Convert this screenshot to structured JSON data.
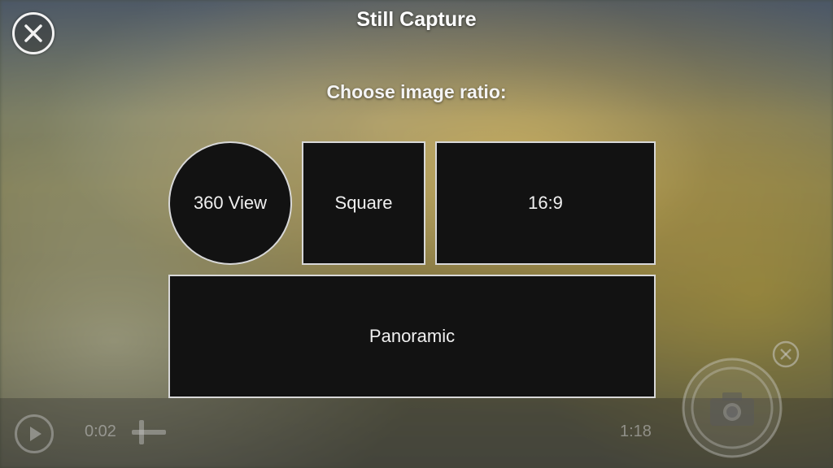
{
  "header": {
    "title": "Still Capture",
    "close_icon": "close-icon"
  },
  "prompt": {
    "text": "Choose image ratio:"
  },
  "ratio_options": [
    {
      "label": "360 View",
      "shape": "circle"
    },
    {
      "label": "Square",
      "shape": "square"
    },
    {
      "label": "16:9",
      "shape": "rectangle"
    },
    {
      "label": "Panoramic",
      "shape": "wide-rectangle"
    }
  ],
  "playback": {
    "current_time": "0:02",
    "total_time": "1:18",
    "play_icon": "play-icon",
    "add_icon": "add-icon"
  },
  "capture": {
    "shutter_icon": "camera-icon",
    "dismiss_icon": "close-icon"
  },
  "colors": {
    "option_border": "#d8d8d8",
    "option_fill": "#121212",
    "text": "#ffffff"
  }
}
